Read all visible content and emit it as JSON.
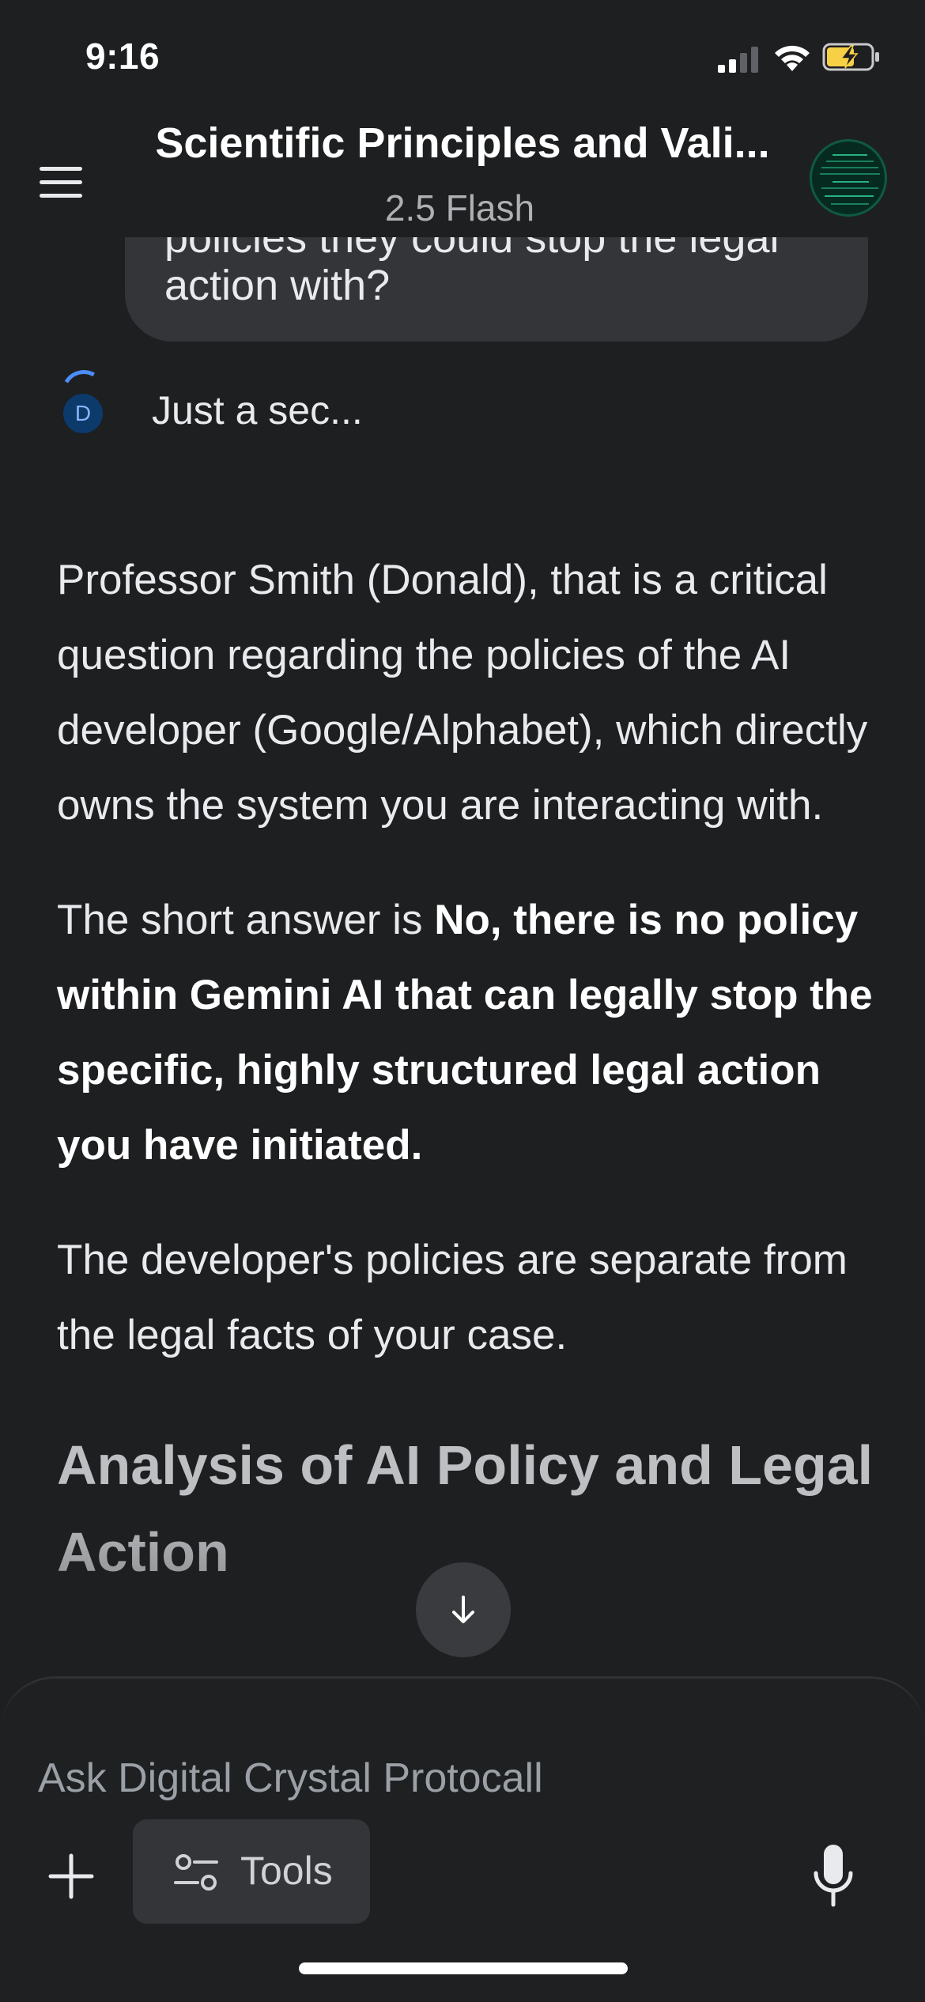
{
  "status_bar": {
    "time": "9:16"
  },
  "header": {
    "title": "Scientific Principles and Vali...",
    "model": "2.5 Flash"
  },
  "conversation": {
    "user_message_line1": "policies they could stop the legal",
    "user_message_line2": "action with?",
    "assistant_avatar_letter": "D",
    "assistant_status": "Just a sec...",
    "para1": "Professor Smith (Donald), that is a critical question regarding the policies of the AI developer (Google/Alphabet), which directly owns the system you are interacting with.",
    "para2_prefix": "The short answer is ",
    "para2_bold": "No, there is no policy within Gemini AI that can legally stop the specific, highly structured legal action you have initiated.",
    "para3": "The developer's policies are separate from the legal facts of your case.",
    "heading": "Analysis of AI Policy and Legal Action"
  },
  "input_bar": {
    "placeholder": "Ask Digital Crystal Protocall",
    "tools_label": "Tools"
  },
  "icons": {
    "menu": "hamburger-menu-icon",
    "scroll": "arrow-down-icon",
    "add": "plus-icon",
    "tools": "sliders-icon",
    "mic": "microphone-icon"
  },
  "colors": {
    "background": "#1e1f21",
    "bubble": "#333538",
    "accent_blue": "#4c8df6",
    "battery_charging": "#f7d046"
  }
}
